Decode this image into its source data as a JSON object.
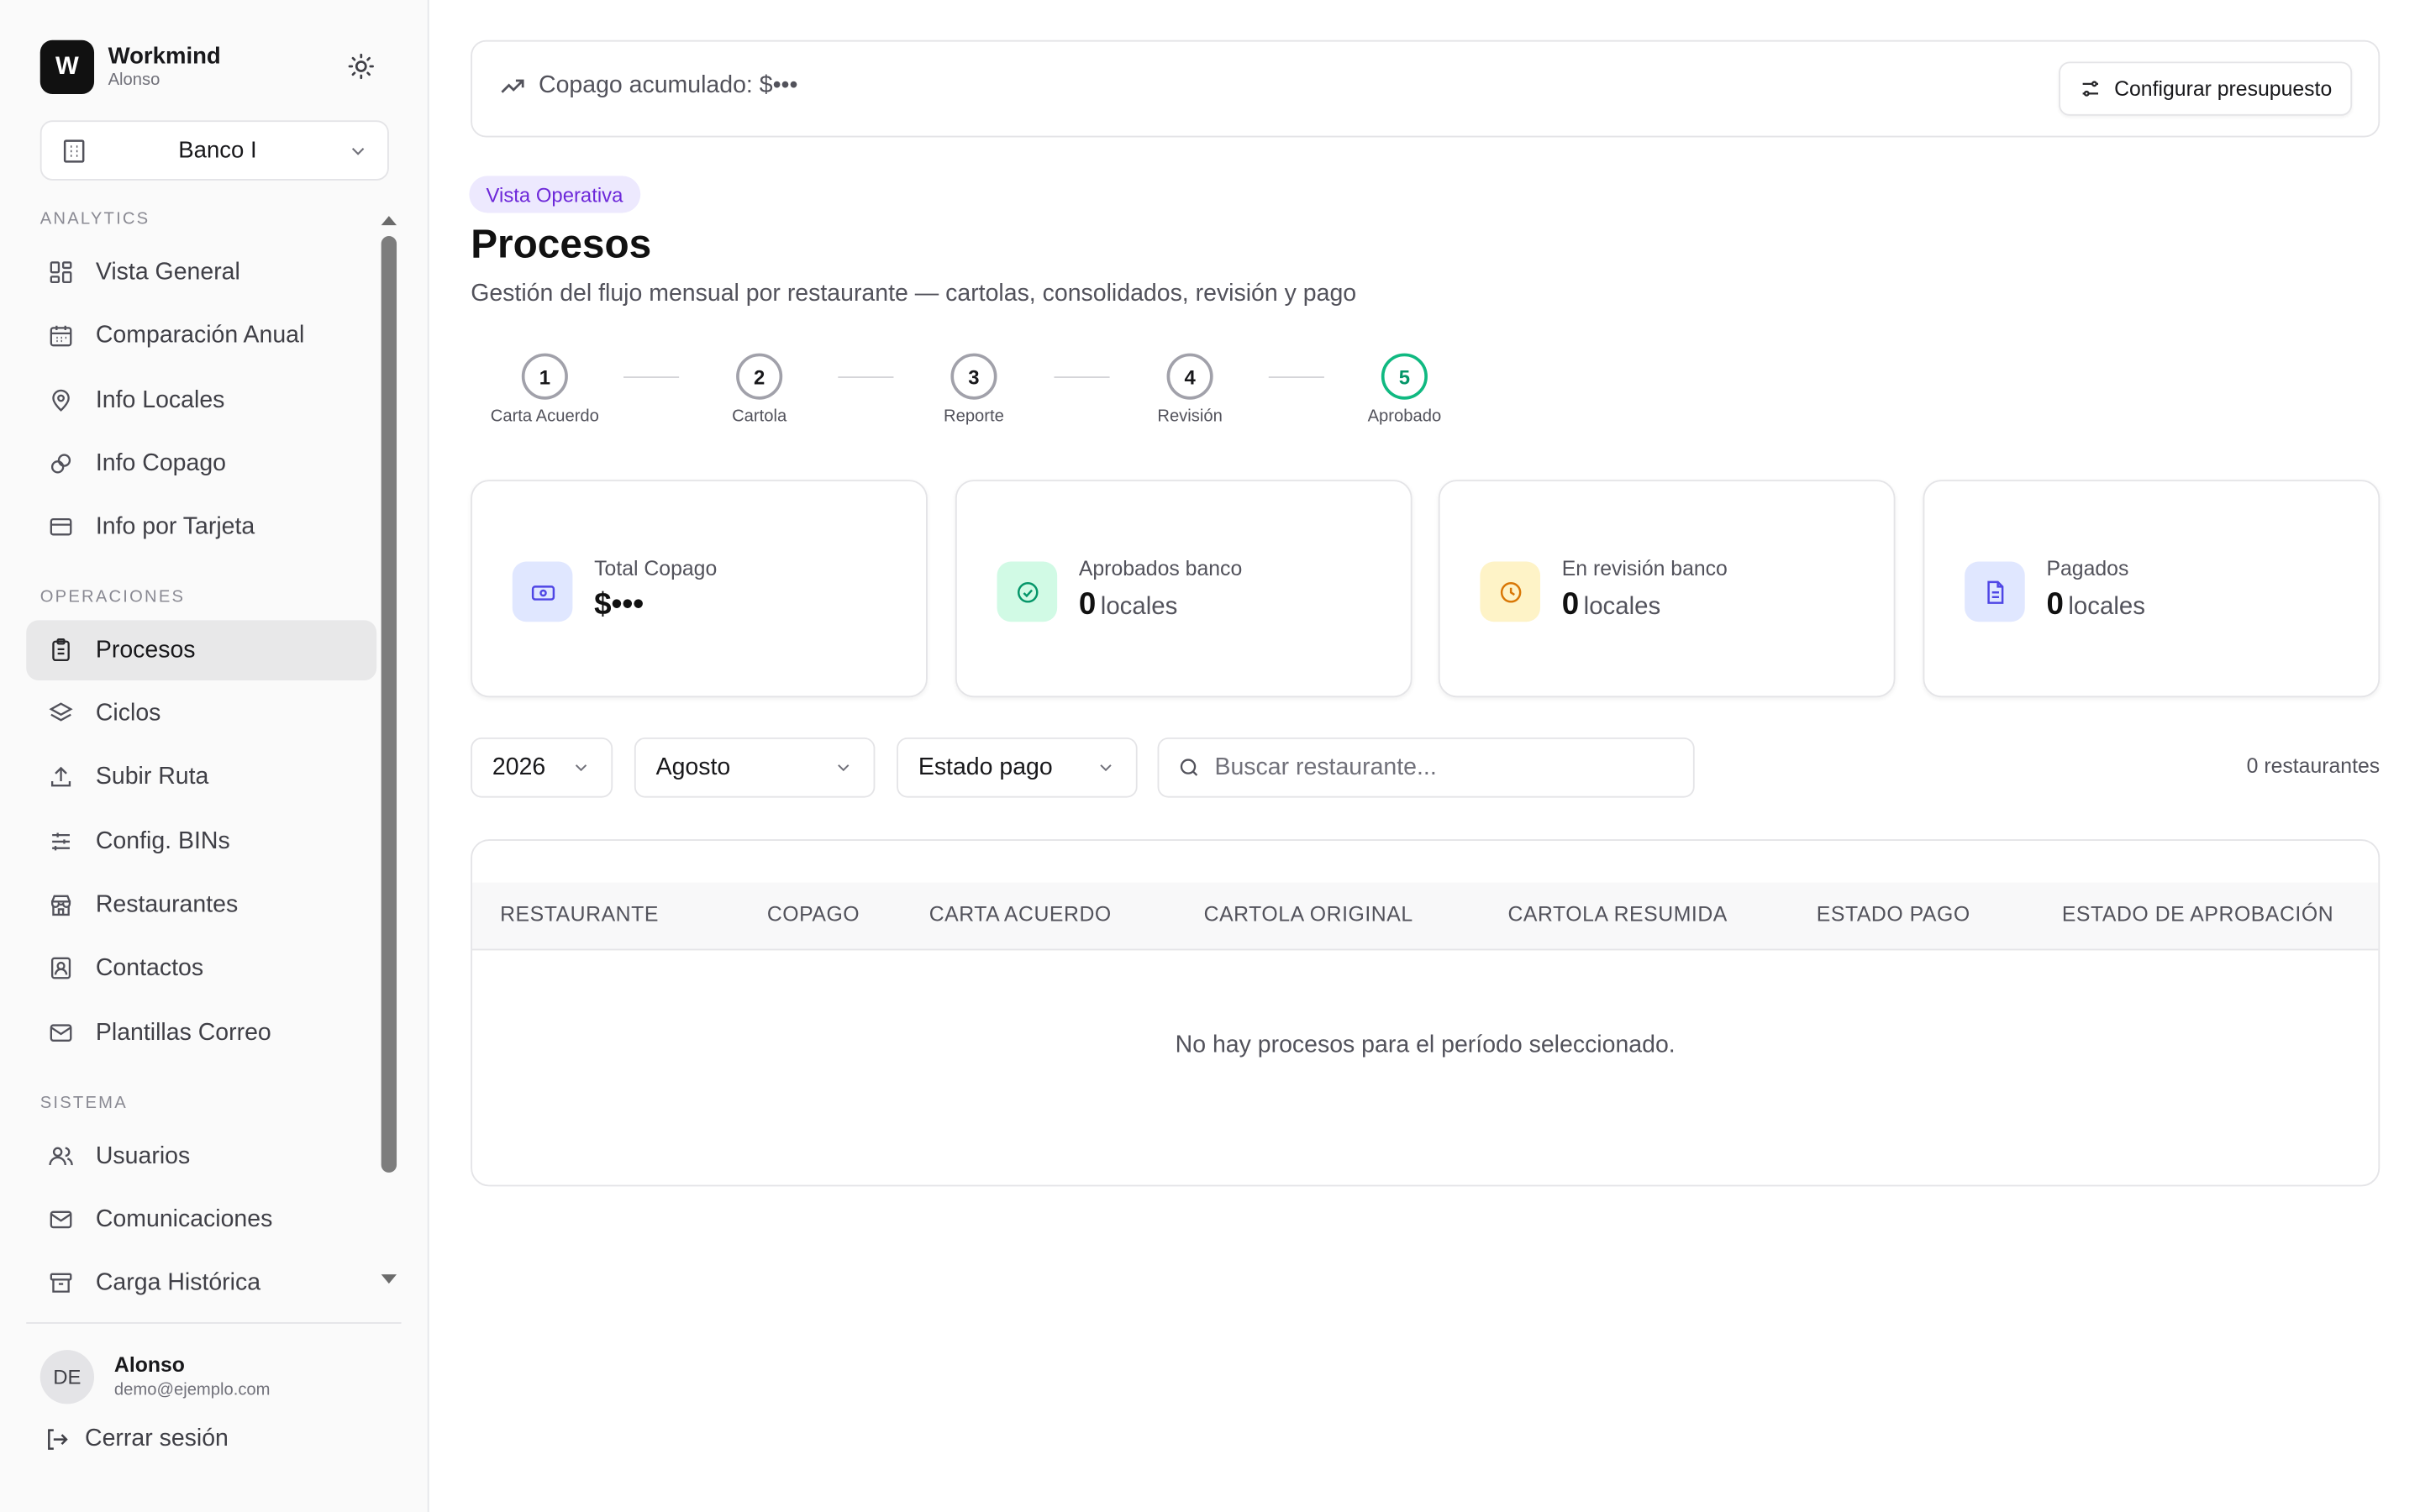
{
  "brand": {
    "logo_letter": "W",
    "name": "Workmind",
    "subtitle": "Alonso"
  },
  "bank_selector": {
    "value": "Banco I"
  },
  "sidebar": {
    "sections": [
      {
        "title": "ANALYTICS"
      },
      {
        "title": "OPERACIONES"
      },
      {
        "title": "SISTEMA"
      }
    ],
    "items": [
      {
        "label": "Vista General",
        "icon": "grid-icon"
      },
      {
        "label": "Comparación Anual",
        "icon": "calendar-icon"
      },
      {
        "label": "Info Locales",
        "icon": "map-pin-icon"
      },
      {
        "label": "Info Copago",
        "icon": "coins-icon"
      },
      {
        "label": "Info por Tarjeta",
        "icon": "credit-card-icon"
      },
      {
        "label": "Procesos",
        "icon": "clipboard-icon",
        "active": true
      },
      {
        "label": "Ciclos",
        "icon": "layers-icon"
      },
      {
        "label": "Subir Ruta",
        "icon": "upload-icon"
      },
      {
        "label": "Config. BINs",
        "icon": "sliders-icon"
      },
      {
        "label": "Restaurantes",
        "icon": "store-icon"
      },
      {
        "label": "Contactos",
        "icon": "contact-icon"
      },
      {
        "label": "Plantillas Correo",
        "icon": "mail-icon"
      },
      {
        "label": "Usuarios",
        "icon": "users-icon"
      },
      {
        "label": "Comunicaciones",
        "icon": "mail-icon"
      },
      {
        "label": "Carga Histórica",
        "icon": "archive-icon"
      }
    ]
  },
  "user": {
    "initials": "DE",
    "name": "Alonso",
    "email": "demo@ejemplo.com"
  },
  "logout_label": "Cerrar sesión",
  "topbar": {
    "copago_label": "Copago acumulado: $•••",
    "budget_button": "Configurar presupuesto"
  },
  "page": {
    "badge": "Vista Operativa",
    "title": "Procesos",
    "subtitle": "Gestión del flujo mensual por restaurante — cartolas, consolidados, revisión y pago"
  },
  "steps": [
    {
      "number": "1",
      "label": "Carta Acuerdo"
    },
    {
      "number": "2",
      "label": "Cartola"
    },
    {
      "number": "3",
      "label": "Reporte"
    },
    {
      "number": "4",
      "label": "Revisión"
    },
    {
      "number": "5",
      "label": "Aprobado",
      "done": true
    }
  ],
  "cards": [
    {
      "title": "Total Copago",
      "value": "$•••",
      "unit": "",
      "icon": "money-icon",
      "color": "#e0e7ff"
    },
    {
      "title": "Aprobados banco",
      "value": "0",
      "unit": "locales",
      "icon": "check-circle-icon",
      "color": "#d1fae5"
    },
    {
      "title": "En revisión banco",
      "value": "0",
      "unit": "locales",
      "icon": "clock-icon",
      "color": "#fef3c7"
    },
    {
      "title": "Pagados",
      "value": "0",
      "unit": "locales",
      "icon": "document-icon",
      "color": "#e0e7ff"
    }
  ],
  "filters": {
    "year": "2026",
    "month": "Agosto",
    "payment_status": "Estado pago",
    "search_placeholder": "Buscar restaurante...",
    "count": "0 restaurantes"
  },
  "table": {
    "columns": [
      "RESTAURANTE",
      "COPAGO",
      "CARTA ACUERDO",
      "CARTOLA ORIGINAL",
      "CARTOLA RESUMIDA",
      "ESTADO PAGO",
      "ESTADO DE APROBACIÓN"
    ],
    "empty_message": "No hay procesos para el período seleccionado."
  }
}
